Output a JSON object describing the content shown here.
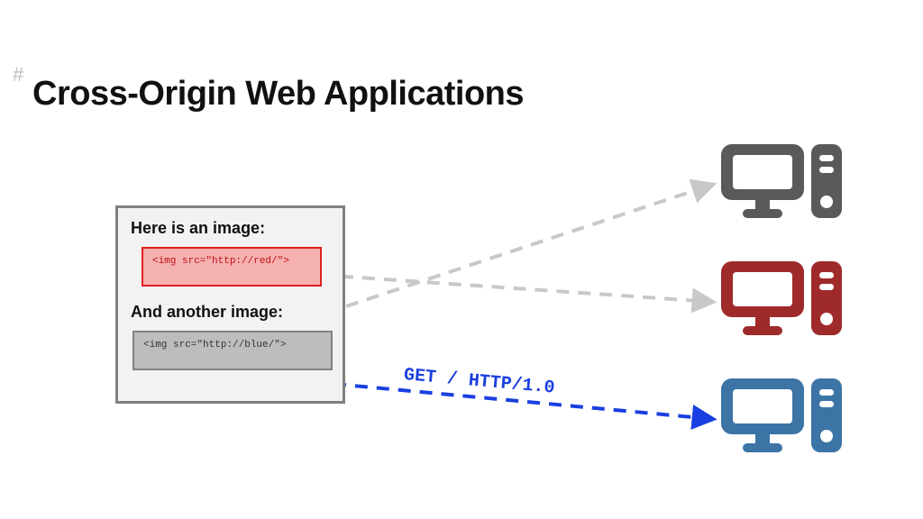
{
  "title": "Cross-Origin Web Applications",
  "hash": "#",
  "page": {
    "heading1": "Here is an image:",
    "img1_code": "<img src=\"http://red/\">",
    "heading2": "And another image:",
    "img2_code": "<img src=\"http://blue/\">"
  },
  "request_label": "GET / HTTP/1.0",
  "colors": {
    "grey": "#5a5a5a",
    "red": "#9f2a2a",
    "blue": "#3c74a6",
    "arrow_grey": "#c8c8c8",
    "arrow_blue": "#1a3fe0"
  },
  "servers": [
    {
      "name": "grey-server"
    },
    {
      "name": "red-server"
    },
    {
      "name": "blue-server"
    }
  ]
}
